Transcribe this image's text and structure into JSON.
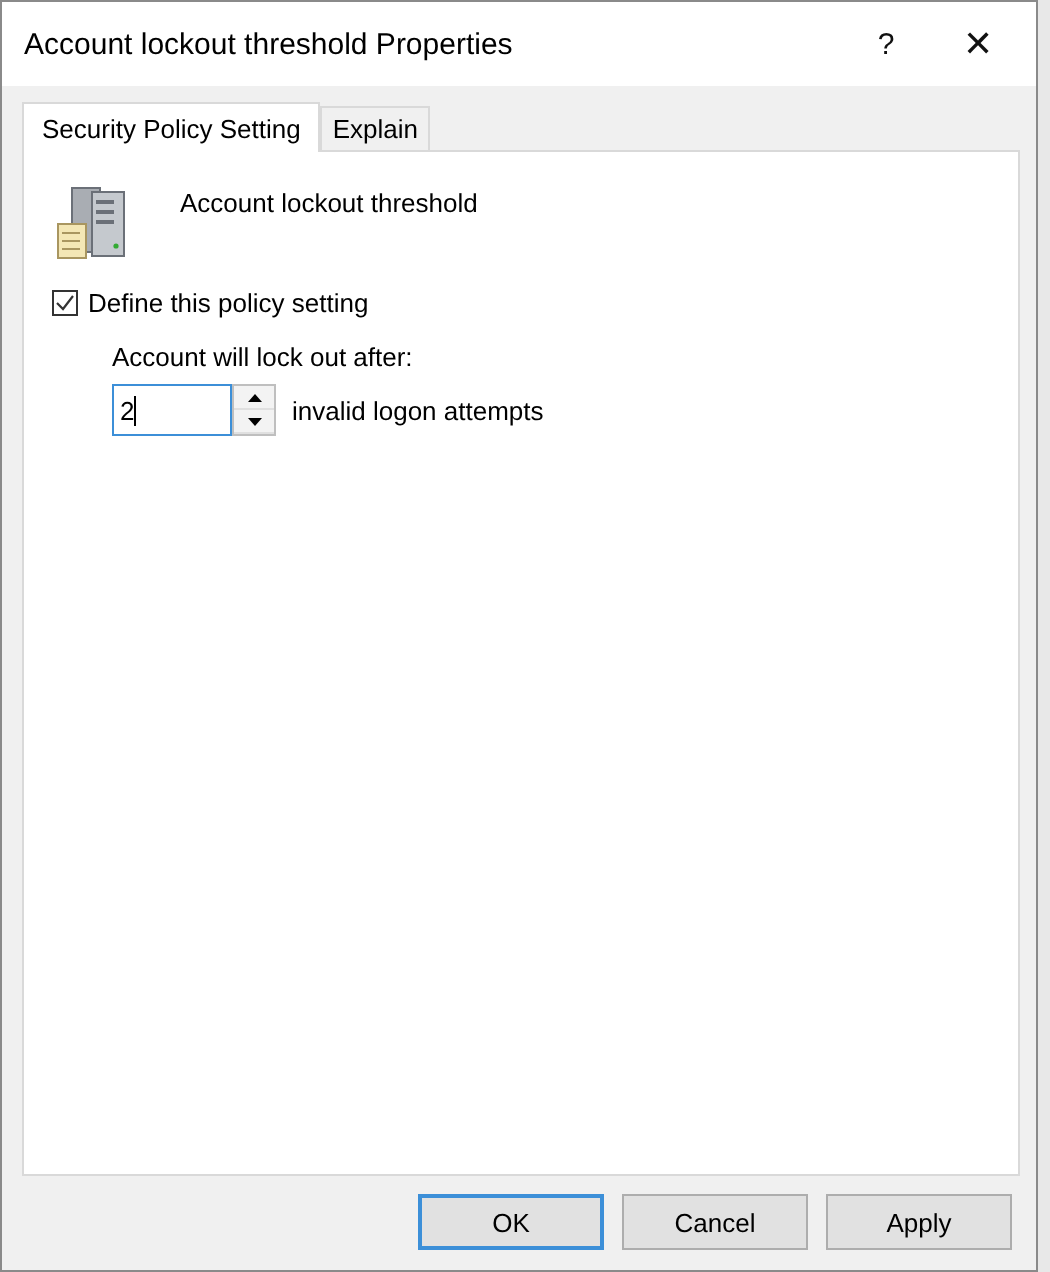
{
  "window": {
    "title": "Account lockout threshold Properties",
    "help": "?",
    "close": "✕"
  },
  "tabs": [
    {
      "label": "Security Policy Setting",
      "selected": true
    },
    {
      "label": "Explain",
      "selected": false
    }
  ],
  "policy": {
    "name": "Account lockout threshold"
  },
  "define": {
    "label": "Define this policy setting",
    "checked": true
  },
  "lockout": {
    "label": "Account will lock out after:",
    "value": "2",
    "suffix": "invalid logon attempts"
  },
  "buttons": [
    {
      "label": "OK",
      "default": true
    },
    {
      "label": "Cancel",
      "default": false
    },
    {
      "label": "Apply",
      "default": false
    }
  ]
}
